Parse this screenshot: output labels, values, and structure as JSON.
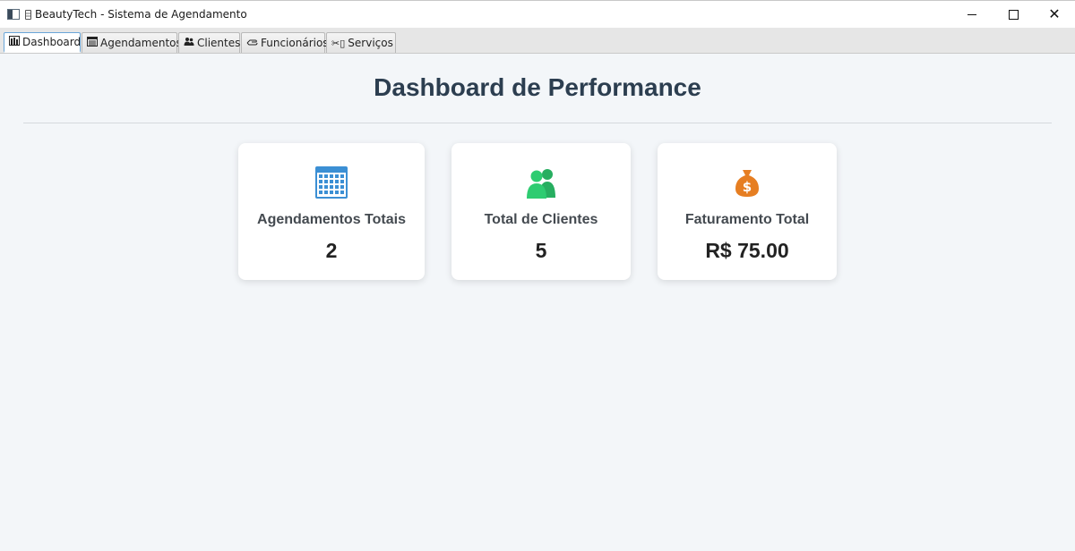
{
  "window": {
    "title": "BeautyTech - Sistema de Agendamento",
    "controls": {
      "minimize": "minimize-icon",
      "maximize": "maximize-icon",
      "close": "close-icon"
    }
  },
  "tabs": [
    {
      "label": "Dashboard",
      "icon": "chart-icon",
      "active": true
    },
    {
      "label": "Agendamentos",
      "icon": "calendar-list-icon",
      "active": false
    },
    {
      "label": "Clientes",
      "icon": "people-icon",
      "active": false
    },
    {
      "label": "Funcionários",
      "icon": "hand-icon",
      "active": false
    },
    {
      "label": "Serviços",
      "icon": "scissors-icon",
      "active": false
    }
  ],
  "page": {
    "title": "Dashboard de Performance"
  },
  "cards": [
    {
      "label": "Agendamentos Totais",
      "value": "2",
      "icon": "calendar-icon",
      "color": "#3b8fd4"
    },
    {
      "label": "Total de Clientes",
      "value": "5",
      "icon": "users-icon",
      "color": "#2ecc71"
    },
    {
      "label": "Faturamento Total",
      "value": "R$ 75.00",
      "icon": "money-bag-icon",
      "color": "#e67e22"
    }
  ]
}
